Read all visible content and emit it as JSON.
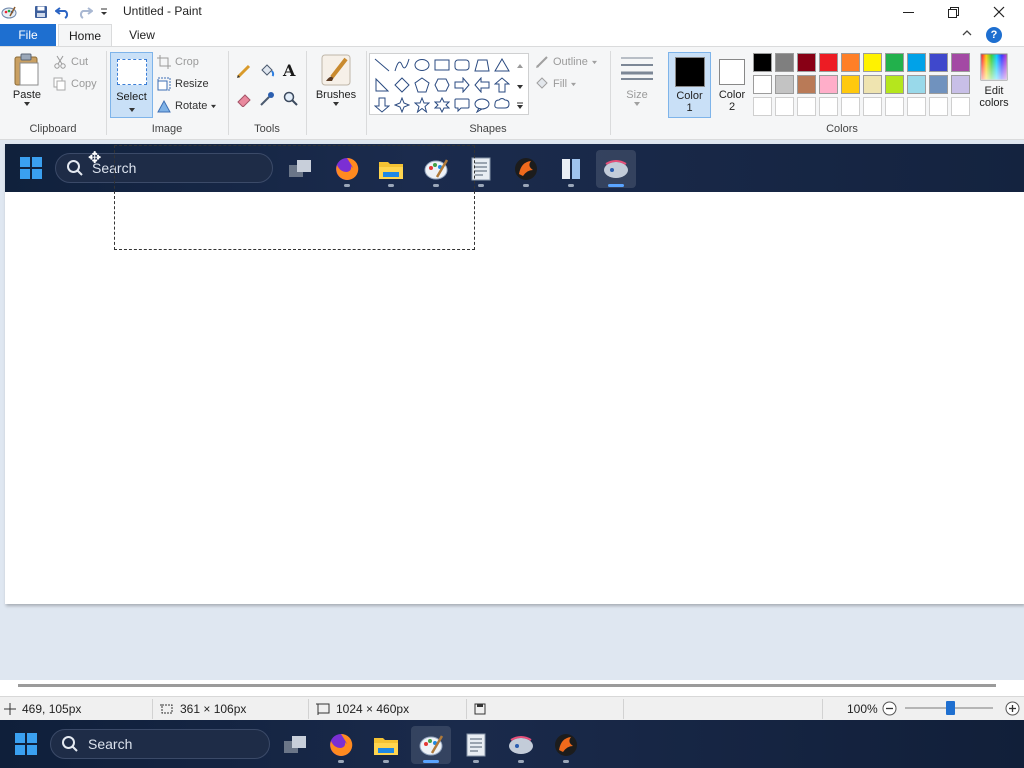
{
  "window": {
    "title": "Untitled - Paint"
  },
  "tabs": [
    {
      "label": "File"
    },
    {
      "label": "Home"
    },
    {
      "label": "View"
    }
  ],
  "ribbon": {
    "clipboard": {
      "group_label": "Clipboard",
      "paste_label": "Paste",
      "cut_label": "Cut",
      "copy_label": "Copy"
    },
    "image": {
      "group_label": "Image",
      "select_label": "Select",
      "crop_label": "Crop",
      "resize_label": "Resize",
      "rotate_label": "Rotate"
    },
    "tools": {
      "group_label": "Tools"
    },
    "brushes": {
      "label": "Brushes"
    },
    "shapes": {
      "group_label": "Shapes",
      "outline_label": "Outline",
      "fill_label": "Fill"
    },
    "size": {
      "label": "Size"
    },
    "colors": {
      "group_label": "Colors",
      "color1_label_line1": "Color",
      "color1_label_line2": "1",
      "color2_label_line1": "Color",
      "color2_label_line2": "2",
      "edit_label_line1": "Edit",
      "edit_label_line2": "colors",
      "color1_value": "#000000",
      "color2_value": "#ffffff",
      "palette_row1": [
        "#000000",
        "#7f7f7f",
        "#880015",
        "#ed1c24",
        "#ff7f27",
        "#fff200",
        "#22b14c",
        "#00a2e8",
        "#3f48cc",
        "#a349a4"
      ],
      "palette_row2": [
        "#ffffff",
        "#c3c3c3",
        "#b97a57",
        "#ffaec9",
        "#ffc90e",
        "#efe4b0",
        "#b5e61d",
        "#99d9ea",
        "#7092be",
        "#c8bfe7"
      ],
      "palette_row3": [
        "#ffffff",
        "#ffffff",
        "#ffffff",
        "#ffffff",
        "#ffffff",
        "#ffffff",
        "#ffffff",
        "#ffffff",
        "#ffffff",
        "#ffffff"
      ]
    }
  },
  "canvas": {
    "pasted_search_text": "Search"
  },
  "statusbar": {
    "cursor_pos": "469, 105px",
    "selection_size": "361 × 106px",
    "image_size": "1024 × 460px",
    "zoom": "100%"
  },
  "taskbar": {
    "search_text": "Search"
  }
}
